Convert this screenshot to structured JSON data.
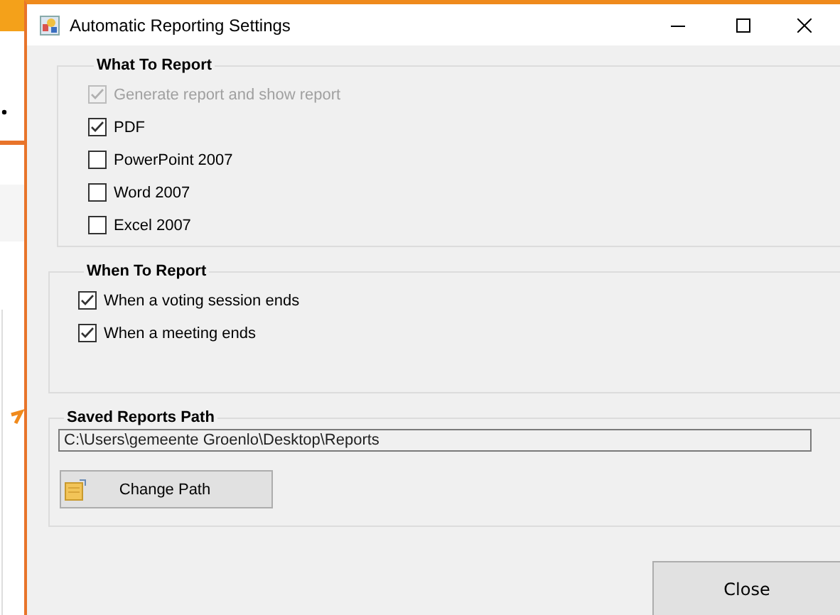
{
  "window": {
    "title": "Automatic Reporting Settings"
  },
  "sections": [
    {
      "kind": "checklist",
      "title": "What To Report",
      "items": [
        {
          "label": "Generate report and show report",
          "checked": true,
          "disabled": true
        },
        {
          "label": "PDF",
          "checked": true,
          "disabled": false
        },
        {
          "label": "PowerPoint 2007",
          "checked": false,
          "disabled": false
        },
        {
          "label": "Word 2007",
          "checked": false,
          "disabled": false
        },
        {
          "label": "Excel 2007",
          "checked": false,
          "disabled": false
        }
      ]
    },
    {
      "kind": "checklist",
      "title": "When To Report",
      "items": [
        {
          "label": "When a voting session ends",
          "checked": true,
          "disabled": false
        },
        {
          "label": "When a meeting ends",
          "checked": true,
          "disabled": false
        }
      ]
    },
    {
      "kind": "path",
      "title": "Saved Reports Path",
      "value": "C:\\Users\\gemeente Groenlo\\Desktop\\Reports",
      "button": "Change Path"
    }
  ],
  "close_button": "Close"
}
